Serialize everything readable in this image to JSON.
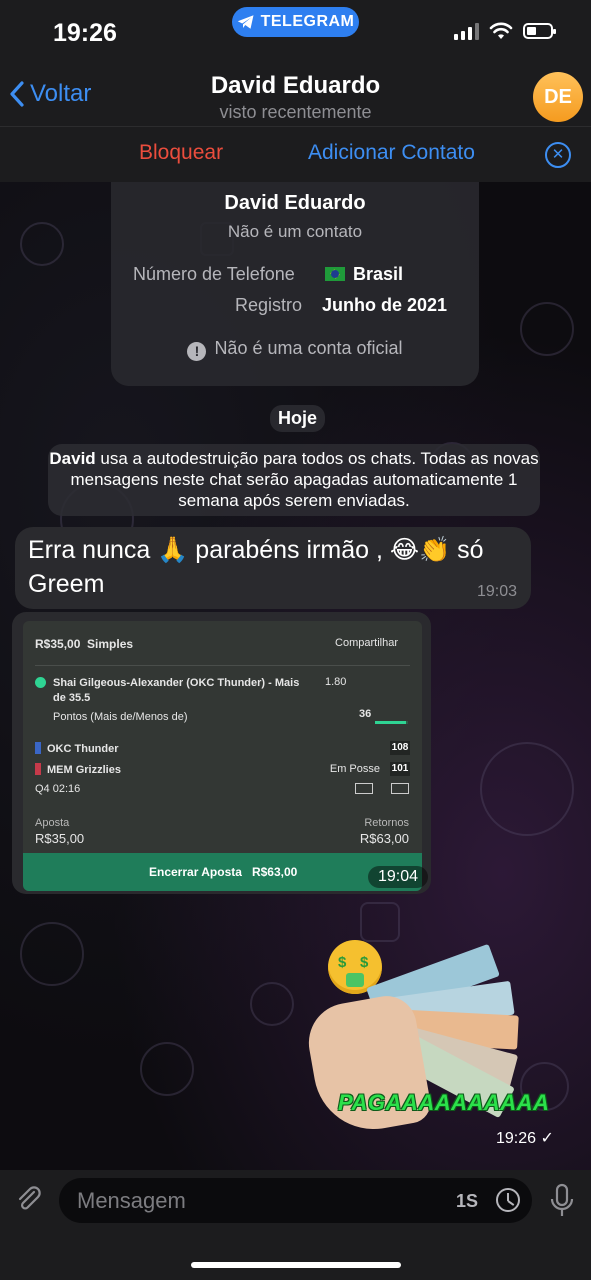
{
  "status_bar": {
    "time": "19:26",
    "app_pill": "TELEGRAM"
  },
  "header": {
    "back_label": "Voltar",
    "title": "David Eduardo",
    "subtitle": "visto recentemente",
    "avatar_initials": "DE"
  },
  "action_bar": {
    "block_label": "Bloquear",
    "add_contact_label": "Adicionar Contato"
  },
  "info_card": {
    "name": "David Eduardo",
    "status": "Não é um contato",
    "phone_label": "Número de Telefone",
    "phone_country": "Brasil",
    "registration_label": "Registro",
    "registration_value": "Junho de 2021",
    "warning": "Não é uma conta oficial"
  },
  "date_separator": "Hoje",
  "service_message": {
    "bold_name": "David",
    "text": " usa a autodestruição para todos os chats. Todas as novas mensagens neste chat serão apagadas automaticamente 1 semana após serem enviadas."
  },
  "messages": [
    {
      "text": "Erra nunca 🙏 parabéns irmão , 😂👏 só Greem",
      "time": "19:03"
    }
  ],
  "bet_card": {
    "stake_header": "R$35,00",
    "bet_type": "Simples",
    "share": "Compartilhar",
    "selection": "Shai Gilgeous-Alexander (OKC Thunder) - Mais de 35.5",
    "odds": "1.80",
    "market": "Pontos (Mais de/Menos de)",
    "progress_value": "36",
    "progress_fraction": 0.95,
    "team1": "OKC Thunder",
    "team1_score": "108",
    "team2": "MEM Grizzlies",
    "team2_score": "101",
    "possession": "Em Posse",
    "clock": "Q4  02:16",
    "stake_label": "Aposta",
    "stake_value": "R$35,00",
    "returns_label": "Retornos",
    "returns_value": "R$63,00",
    "cashout_label": "Encerrar Aposta",
    "cashout_value": "R$63,00",
    "time": "19:04",
    "accent_color": "#2fd493"
  },
  "sticker": {
    "caption": "PAGAAAAAAAAAA",
    "time": "19:26",
    "read_mark": "✓"
  },
  "input": {
    "placeholder": "Mensagem",
    "timer_label": "1S"
  },
  "colors": {
    "accent_blue": "#3d8ef2",
    "danger_red": "#eb4d3d"
  }
}
